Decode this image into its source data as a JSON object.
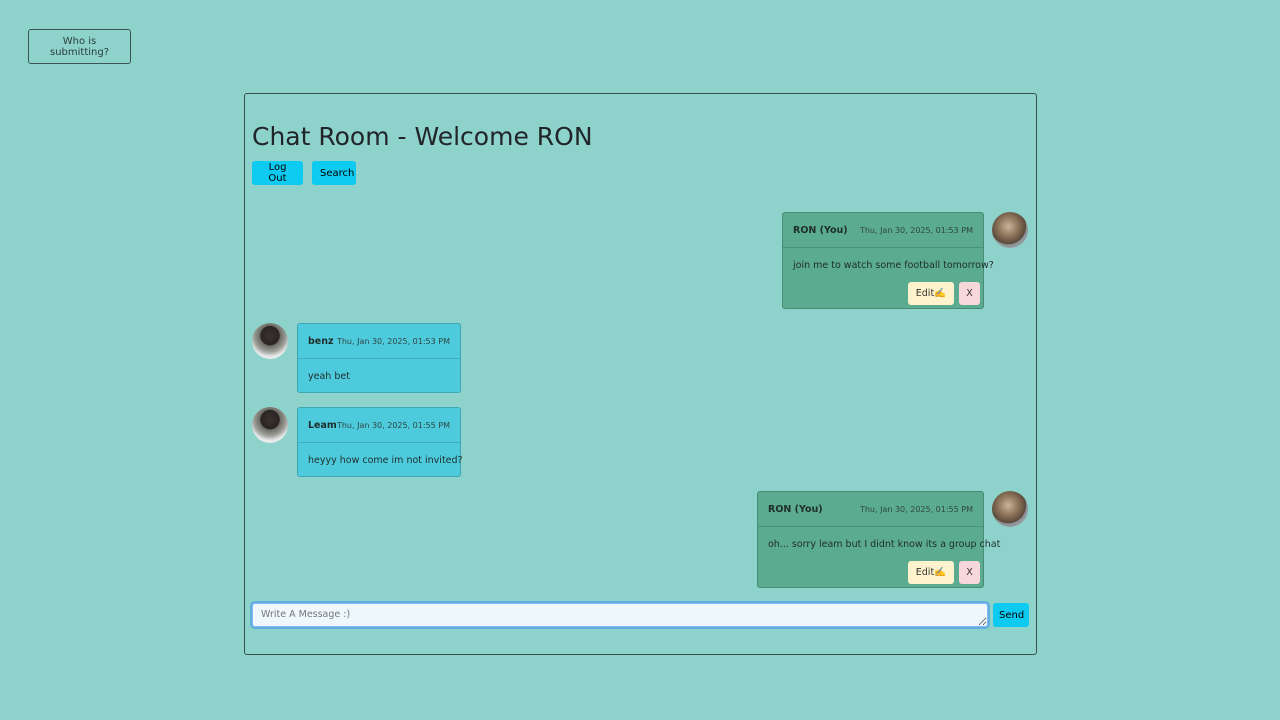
{
  "who_button": "Who is submitting?",
  "header": {
    "title": "Chat Room - Welcome RON",
    "logout_label": "Log Out",
    "search_label": "Search"
  },
  "messages": [
    {
      "user": "RON (You)",
      "time": "Thu, Jan 30, 2025, 01:53 PM",
      "text": "join me to watch some football tomorrow?",
      "edit_label": "Edit✍️",
      "delete_label": "X",
      "own": true
    },
    {
      "user": "benz",
      "time": "Thu, Jan 30, 2025, 01:53 PM",
      "text": "yeah bet",
      "own": false
    },
    {
      "user": "Leam",
      "time": "Thu, Jan 30, 2025, 01:55 PM",
      "text": "heyyy how come im not invited?",
      "own": false
    },
    {
      "user": "RON (You)",
      "time": "Thu, Jan 30, 2025, 01:55 PM",
      "text": "oh... sorry leam but I didnt know its a group chat",
      "edit_label": "Edit✍️",
      "delete_label": "X",
      "own": true
    }
  ],
  "composer": {
    "placeholder": "Write A Message :)",
    "send_label": "Send"
  }
}
